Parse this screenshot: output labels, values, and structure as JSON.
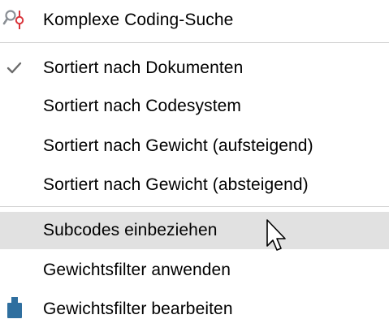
{
  "menu": {
    "items": [
      {
        "label": "Komplexe Coding-Suche",
        "icon": "search-coding-icon",
        "checked": false
      },
      {
        "label": "Sortiert nach Dokumenten",
        "icon": "checkmark-icon",
        "checked": true
      },
      {
        "label": "Sortiert nach Codesystem",
        "checked": false
      },
      {
        "label": "Sortiert nach Gewicht (aufsteigend)",
        "checked": false
      },
      {
        "label": "Sortiert nach Gewicht (absteigend)",
        "checked": false
      },
      {
        "label": "Subcodes einbeziehen",
        "highlighted": true,
        "checked": false
      },
      {
        "label": "Gewichtsfilter anwenden",
        "checked": false
      },
      {
        "label": "Gewichtsfilter bearbeiten",
        "icon": "weight-icon",
        "checked": false
      }
    ],
    "colors": {
      "highlight": "#e1e1e1",
      "separator": "#d2d2d2",
      "icon_red": "#d9343a",
      "icon_gray": "#8a8f95",
      "icon_blue": "#2f6f9f",
      "check_gray": "#6b6b6b"
    }
  }
}
